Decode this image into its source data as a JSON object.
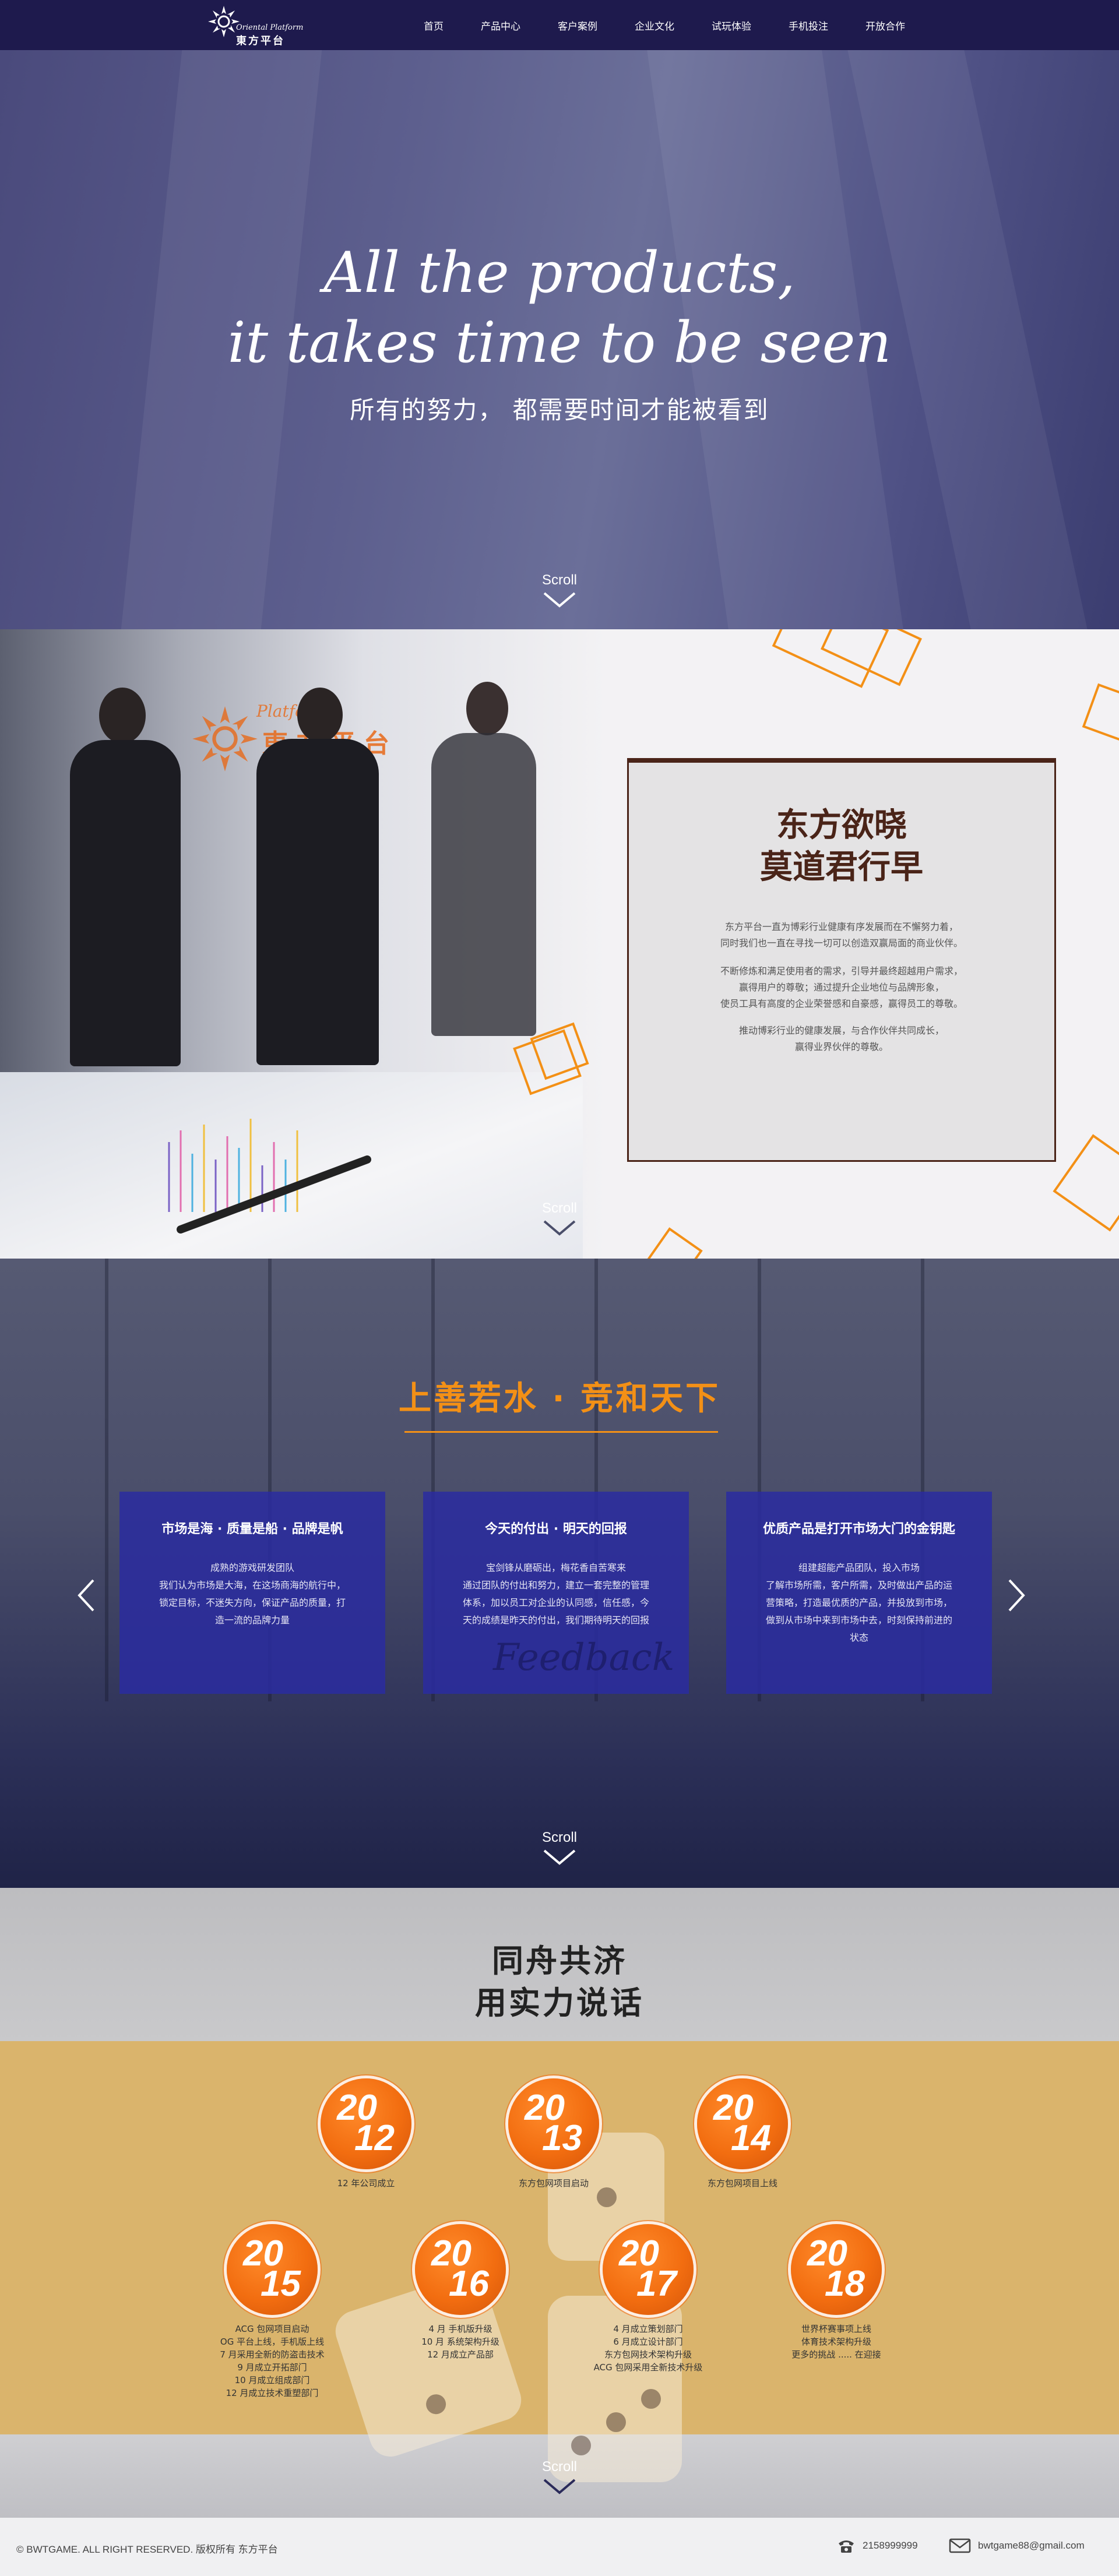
{
  "nav": {
    "logo_en": "Oriental  Platform",
    "logo_cn": "東方平台",
    "items": [
      "首页",
      "产品中心",
      "客户案例",
      "企业文化",
      "试玩体验",
      "手机投注",
      "开放合作"
    ]
  },
  "hero": {
    "title_line1": "All the products,",
    "title_line2": "it takes time to be seen",
    "subtitle": "所有的努力，  都需要时间才能被看到",
    "scroll": "Scroll"
  },
  "about": {
    "photo_logo_en": "Platform",
    "photo_logo_cn": "東方平台",
    "title_line1": "东方欲晓",
    "title_line2": "莫道君行早",
    "paragraphs": [
      [
        "东方平台一直为博彩行业健康有序发展而在不懈努力着，",
        "同时我们也一直在寻找一切可以创造双赢局面的商业伙伴。"
      ],
      [
        "不断修炼和满足使用者的需求，引导并最终超越用户需求，",
        "赢得用户的尊敬；通过提升企业地位与品牌形象，",
        "使员工具有高度的企业荣誉感和自豪感，赢得员工的尊敬。"
      ],
      [
        "推动博彩行业的健康发展，与合作伙伴共同成长，",
        "赢得业界伙伴的尊敬。"
      ]
    ],
    "scroll": "Scroll",
    "accent_color": "#f39016",
    "card_border_color": "#4a2418"
  },
  "values": {
    "title": "上善若水 · 竞和天下",
    "cards": [
      {
        "title": "市场是海 · 质量是船 · 品牌是帆",
        "lines": [
          "成熟的游戏研发团队",
          "我们认为市场是大海，在这场商海的航行中，",
          "锁定目标，不迷失方向，保证产品的质量，打",
          "造一流的品牌力量"
        ]
      },
      {
        "title": "今天的付出 · 明天的回报",
        "lines": [
          "宝剑锋从磨砺出，梅花香自苦寒来",
          "通过团队的付出和努力，建立一套完整的管理",
          "体系，加以员工对企业的认同感，信任感，今",
          "天的成绩是昨天的付出，我们期待明天的回报"
        ],
        "image_text": "Feedback"
      },
      {
        "title": "优质产品是打开市场大门的金钥匙",
        "lines": [
          "组建超能产品团队，投入市场",
          "了解市场所需，客户所需，及时做出产品的运",
          "营策略，打造最优质的产品，并投放到市场，",
          "做到从市场中来到市场中去，时刻保持前进的",
          "状态"
        ]
      }
    ],
    "scroll": "Scroll",
    "card_color": "#2a2ca0"
  },
  "timeline": {
    "title_line1": "同舟共济",
    "title_line2": "用实力说话",
    "years": [
      {
        "top": "20",
        "bottom": "12",
        "lines": [
          "12 年公司成立"
        ]
      },
      {
        "top": "20",
        "bottom": "13",
        "lines": [
          "东方包网项目启动"
        ]
      },
      {
        "top": "20",
        "bottom": "14",
        "lines": [
          "东方包网项目上线"
        ]
      },
      {
        "top": "20",
        "bottom": "15",
        "lines": [
          "ACG 包网项目启动",
          "OG 平台上线，手机版上线",
          "7 月采用全新的防盗击技术",
          "9 月成立开拓部门",
          "10 月成立组成部门",
          "12 月成立技术重塑部门"
        ]
      },
      {
        "top": "20",
        "bottom": "16",
        "lines": [
          "4 月 手机版升级",
          "10 月 系统架构升级",
          "12 月成立产品部"
        ]
      },
      {
        "top": "20",
        "bottom": "17",
        "lines": [
          "4 月成立策划部门",
          "6 月成立设计部门",
          "东方包网技术架构升级",
          "ACG 包网采用全新技术升级"
        ]
      },
      {
        "top": "20",
        "bottom": "18",
        "lines": [
          "世界杯赛事项上线",
          "体育技术架构升级",
          "更多的挑战 ..... 在迎接"
        ]
      }
    ],
    "scroll": "Scroll",
    "band_color": "#dab46c",
    "year_color": "#f26d10"
  },
  "footer": {
    "copyright": "© BWTGAME. ALL RIGHT RESERVED. 版权所有 东方平台",
    "phone": "2158999999",
    "email": "bwtgame88@gmail.com"
  }
}
